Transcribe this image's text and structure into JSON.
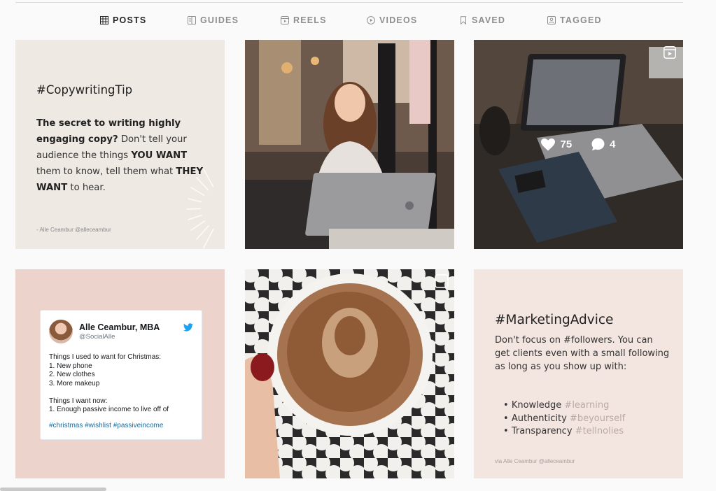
{
  "tabs": [
    {
      "label": "POSTS",
      "icon": "grid-icon",
      "active": true
    },
    {
      "label": "GUIDES",
      "icon": "guides-icon"
    },
    {
      "label": "REELS",
      "icon": "reels-icon"
    },
    {
      "label": "VIDEOS",
      "icon": "play-icon"
    },
    {
      "label": "SAVED",
      "icon": "bookmark-icon"
    },
    {
      "label": "TAGGED",
      "icon": "tagged-icon"
    }
  ],
  "posts": {
    "copywriting": {
      "hashtag": "#CopywritingTip",
      "body_parts": [
        "The secret to writing highly engaging copy?",
        " Don't tell your audience the things ",
        "YOU WANT",
        " them to know, tell them what ",
        "THEY WANT",
        " to hear."
      ],
      "credit": "- Alle Ceambur @alleceambur"
    },
    "laptop": {
      "likes": "75",
      "comments": "4"
    },
    "tweet": {
      "name": "Alle Ceambur, MBA",
      "handle": "@SocialAlle",
      "lines": [
        "Things I used to want for Christmas:",
        "1. New phone",
        "2. New clothes",
        "3. More makeup",
        "",
        "Things I want now:",
        "1. Enough passive income to live off of"
      ],
      "hashtags": "#christmas #wishlist #passiveincome"
    },
    "marketing": {
      "hashtag": "#MarketingAdvice",
      "body": "Don't focus on #followers. You can get clients even with a small following as long as you show up with:",
      "items": [
        {
          "word": "Knowledge",
          "tag": "#learning"
        },
        {
          "word": "Authenticity",
          "tag": "#beyourself"
        },
        {
          "word": "Transparency",
          "tag": "#tellnolies"
        }
      ],
      "credit": "via Alle Ceambur @alleceambur"
    }
  },
  "colors": {
    "tile_beige": "#efe9e4",
    "tile_pink": "#ecd3cc",
    "tile_blush": "#f3e5df",
    "twitter_blue": "#1da1f2"
  }
}
